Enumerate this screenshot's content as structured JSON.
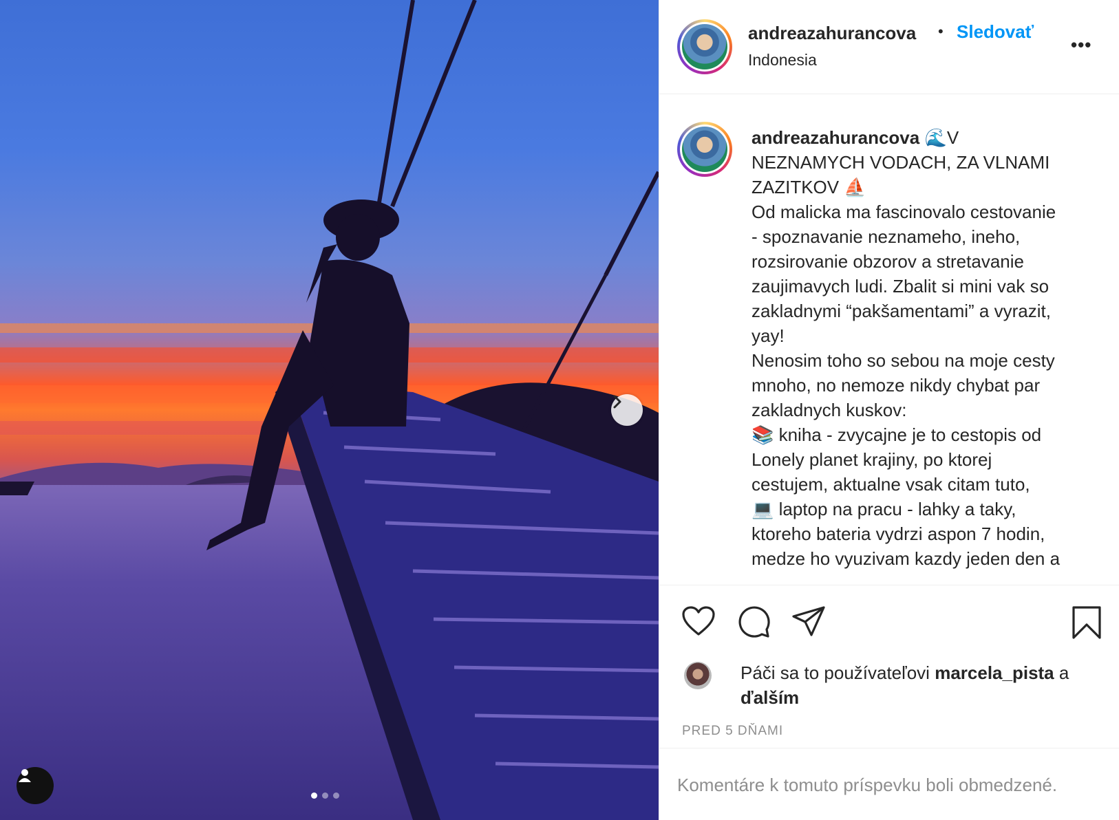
{
  "post": {
    "username": "andreazahurancova",
    "follow_label": "Sledovať",
    "location": "Indonesia",
    "more_label": "•••",
    "caption": "🌊V\nNEZNAMYCH VODACH, ZA VLNAMI\nZAZITKOV ⛵\nOd malicka ma fascinovalo cestovanie\n- spoznavanie neznameho, ineho,\nrozsirovanie obzorov a stretavanie\nzaujimavych ludi. Zbalit si mini vak so\nzakladnymi “pakšamentami” a vyrazit,\nyay!\nNenosim toho so sebou na moje cesty\nmnoho, no nemoze nikdy chybat par\nzakladnych kuskov:\n📚 kniha - zvycajne je to cestopis od\nLonely planet krajiny, po ktorej\ncestujem, aktualne vsak citam tuto,\n💻 laptop na pracu - lahky a taky,\nktoreho bateria vydrzi aspon 7 hodin,\nmedze ho vyuzivam kazdy jeden den a",
    "likes_prefix": "Páči sa to používateľovi",
    "likes_user": "marcela_pista",
    "likes_and": "a",
    "likes_others": "ďalším",
    "timestamp": "PRED 5 DŇAMI",
    "comments_disabled": "Komentáre k tomuto príspevku boli obmedzené."
  },
  "carousel": {
    "slide_count": 3,
    "active_index": 0
  },
  "icons": {
    "like": "heart-icon",
    "comment": "comment-icon",
    "share": "share-icon",
    "save": "bookmark-icon",
    "next": "chevron-right-icon",
    "user_tag": "user-icon"
  },
  "colors": {
    "accent": "#0095f6",
    "text": "#262626",
    "muted": "#8e8e8e"
  }
}
